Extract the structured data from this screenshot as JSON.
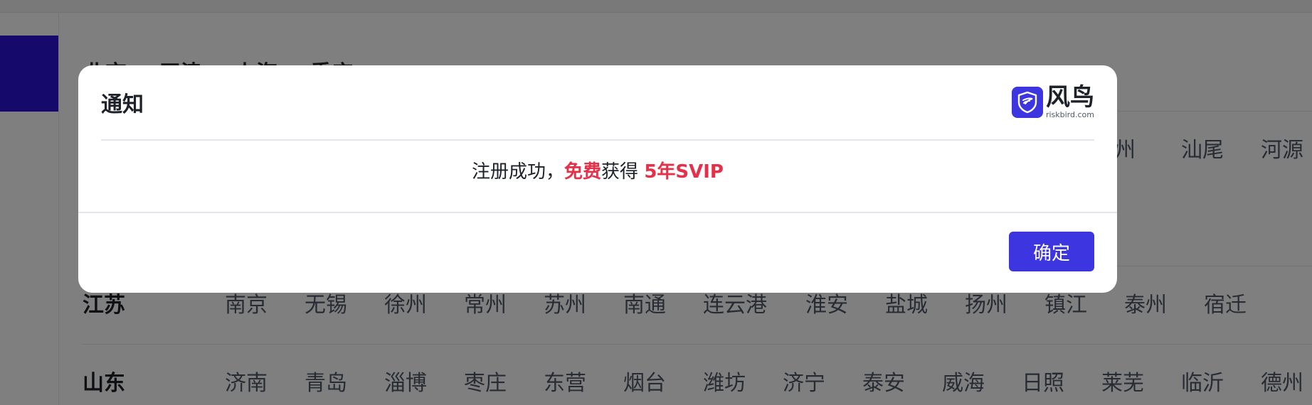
{
  "background": {
    "region_tabs": [
      "北京",
      "天津",
      "上海",
      "重庆"
    ],
    "row1_cities": [
      "梅州",
      "汕尾",
      "河源"
    ],
    "rows": [
      {
        "province": "江苏",
        "cities": [
          "南京",
          "无锡",
          "徐州",
          "常州",
          "苏州",
          "南通",
          "连云港",
          "淮安",
          "盐城",
          "扬州",
          "镇江",
          "泰州",
          "宿迁"
        ]
      },
      {
        "province": "山东",
        "cities": [
          "济南",
          "青岛",
          "淄博",
          "枣庄",
          "东营",
          "烟台",
          "潍坊",
          "济宁",
          "泰安",
          "威海",
          "日照",
          "莱芜",
          "临沂",
          "德州"
        ]
      }
    ]
  },
  "modal": {
    "title": "通知",
    "brand": {
      "name": "风鸟",
      "domain": "riskbird.com"
    },
    "message": {
      "prefix": "注册成功，",
      "free": "免费",
      "middle": "获得 ",
      "reward": "5年SVIP"
    },
    "confirm_label": "确定"
  },
  "colors": {
    "accent": "#3d36e0",
    "highlight": "#e5304a",
    "overlay": "rgba(0,0,0,0.5)"
  },
  "icons": {
    "brand_logo": "shield-icon"
  }
}
